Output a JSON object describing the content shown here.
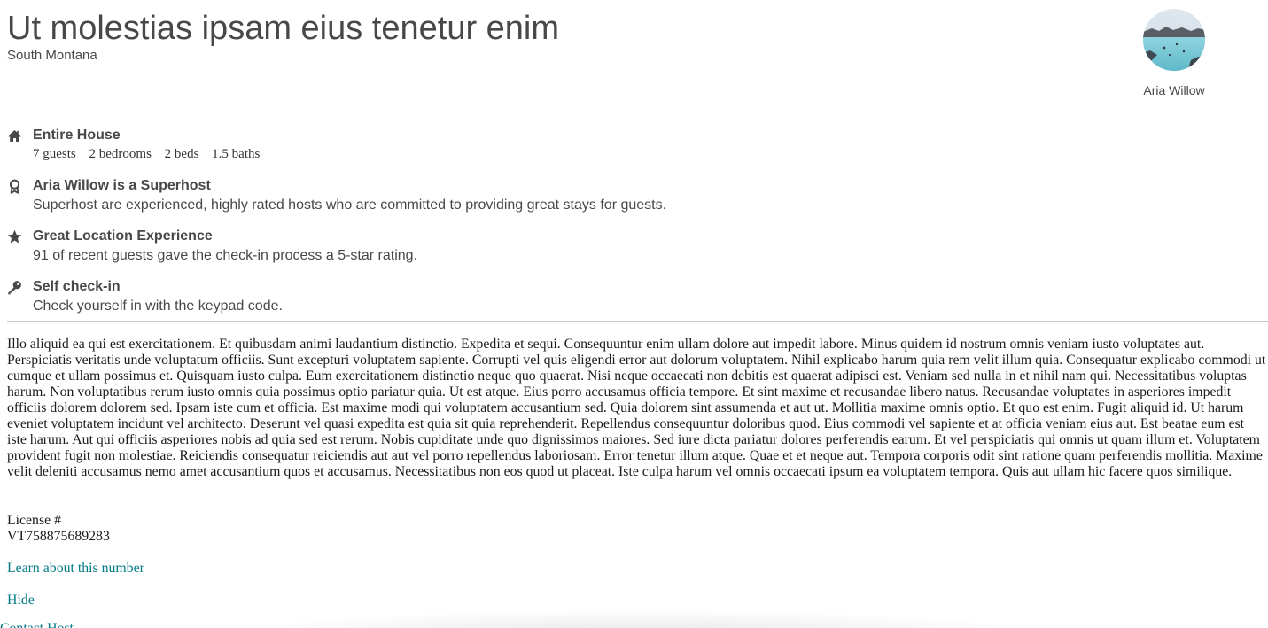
{
  "listing": {
    "title": "Ut molestias ipsam eius tenetur enim",
    "location": "South Montana"
  },
  "host": {
    "name": "Aria Willow",
    "avatar_icon": "avatar-photo"
  },
  "features": [
    {
      "icon": "home-icon",
      "heading": "Entire House",
      "stats": [
        "7 guests",
        "2 bedrooms",
        "2 beds",
        "1.5 baths"
      ]
    },
    {
      "icon": "award-icon",
      "heading": "Aria Willow is a Superhost",
      "description": "Superhost are experienced, highly rated hosts who are committed to providing great stays for guests."
    },
    {
      "icon": "star-icon",
      "heading": "Great Location Experience",
      "description": "91 of recent guests gave the check-in process a 5-star rating."
    },
    {
      "icon": "key-icon",
      "heading": "Self check-in",
      "description": "Check yourself in with the keypad code."
    }
  ],
  "description": "Illo aliquid ea qui est exercitationem. Et quibusdam animi laudantium distinctio. Expedita et sequi. Consequuntur enim ullam dolore aut impedit labore. Minus quidem id nostrum omnis veniam iusto voluptates aut. Perspiciatis veritatis unde voluptatum officiis. Sunt excepturi voluptatem sapiente. Corrupti vel quis eligendi error aut dolorum voluptatem. Nihil explicabo harum quia rem velit illum quia. Consequatur explicabo commodi ut cumque et ullam possimus et. Quisquam iusto culpa. Eum exercitationem distinctio neque quo quaerat. Nisi neque occaecati non debitis est quaerat adipisci est. Veniam sed nulla in et nihil nam qui. Necessitatibus voluptas harum. Non voluptatibus rerum iusto omnis quia possimus optio pariatur quia. Ut est atque. Eius porro accusamus officia tempore. Et sint maxime et recusandae libero natus. Recusandae voluptates in asperiores impedit officiis dolorem dolorem sed. Ipsam iste cum et officia. Est maxime modi qui voluptatem accusantium sed. Quia dolorem sint assumenda et aut ut. Mollitia maxime omnis optio. Et quo est enim. Fugit aliquid id. Ut harum eveniet voluptatem incidunt vel architecto. Deserunt vel quasi expedita est quia sit quia reprehenderit. Repellendus consequuntur doloribus quod. Eius commodi vel sapiente et at officia veniam eius aut. Est beatae eum est iste harum. Aut qui officiis asperiores nobis ad quia sed est rerum. Nobis cupiditate unde quo dignissimos maiores. Sed iure dicta pariatur dolores perferendis earum. Et vel perspiciatis qui omnis ut quam illum et. Voluptatem provident fugit non molestiae. Reiciendis consequatur reiciendis aut aut vel porro repellendus laboriosam. Error tenetur illum atque. Quae et et neque aut. Tempora corporis odit sint ratione quam perferendis mollitia. Maxime velit deleniti accusamus nemo amet accusantium quos et accusamus. Necessitatibus non eos quod ut placeat. Iste culpa harum vel omnis occaecati ipsum ea voluptatem tempora. Quis aut ullam hic facere quos similique.",
  "license": {
    "label": "License #",
    "number": "VT758875689283"
  },
  "links": {
    "learn": "Learn about this number",
    "hide": "Hide",
    "contact": "Contact Host"
  }
}
